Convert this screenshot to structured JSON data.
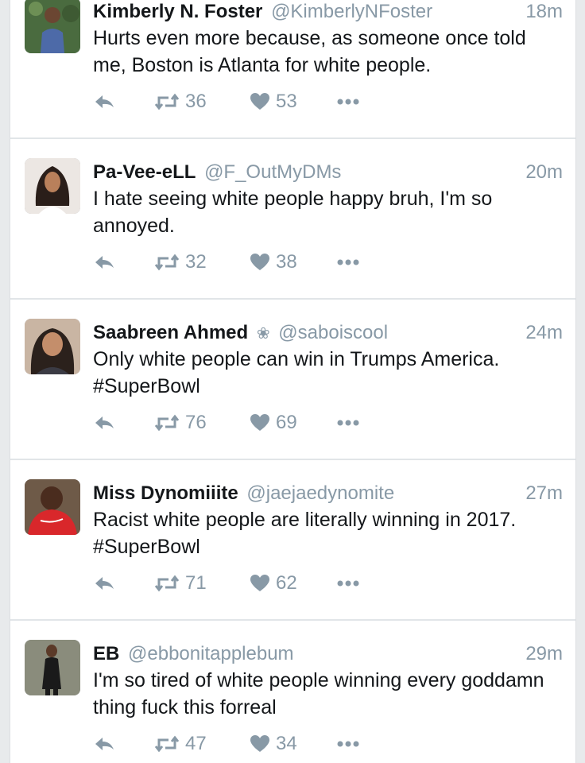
{
  "colors": {
    "text_primary": "#14171a",
    "text_secondary": "#8899a6",
    "divider": "#e1e5e8",
    "background": "#ffffff"
  },
  "icons": {
    "reply": "reply-icon",
    "retweet": "retweet-icon",
    "like": "heart-icon",
    "more": "more-dots-icon"
  },
  "tweets": [
    {
      "name": "Kimberly N. Foster",
      "handle": "@KimberlyNFoster",
      "time": "18m",
      "text": "Hurts even more because, as someone once told me, Boston is Atlanta for white people.",
      "retweets": "36",
      "likes": "53"
    },
    {
      "name": "Pa-Vee-eLL",
      "handle": "@F_OutMyDMs",
      "time": "20m",
      "text": "I hate seeing white people happy bruh, I'm so annoyed.",
      "retweets": "32",
      "likes": "38"
    },
    {
      "name": "Saabreen Ahmed",
      "badge": "❀",
      "handle": "@saboiscool",
      "time": "24m",
      "text": "Only white people can win in Trumps America. #SuperBowl",
      "retweets": "76",
      "likes": "69"
    },
    {
      "name": "Miss Dynomiiite",
      "handle": "@jaejaedynomite",
      "time": "27m",
      "text": "Racist white people are literally winning in 2017. #SuperBowl",
      "retweets": "71",
      "likes": "62"
    },
    {
      "name": "EB",
      "handle": "@ebbonitapplebum",
      "time": "29m",
      "text": "I'm so tired of white people winning every goddamn thing fuck this forreal",
      "retweets": "47",
      "likes": "34"
    }
  ]
}
